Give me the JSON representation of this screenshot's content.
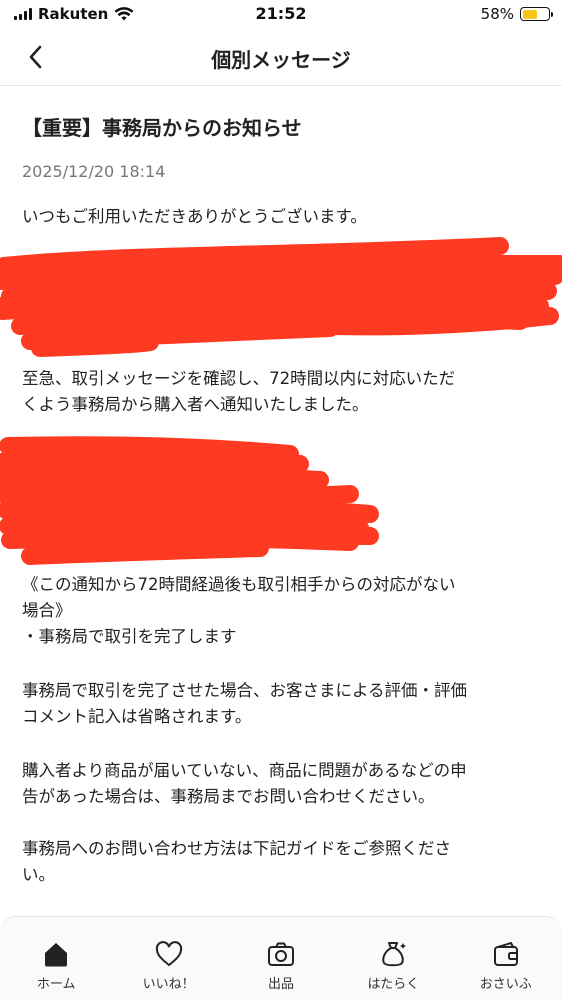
{
  "status_bar": {
    "carrier": "Rakuten",
    "time": "21:52",
    "battery": "58%",
    "battery_level": 0.58,
    "battery_color": "#f5c518"
  },
  "nav": {
    "title": "個別メッセージ",
    "back_icon": "chevron-left-icon"
  },
  "message": {
    "title": "【重要】事務局からのお知らせ",
    "date": "2025/12/20 18:14",
    "p1": "いつもご利用いただきありがとうございます。",
    "p2_line1": "至急、取引メッセージを確認し、72時間以内に対応いただ",
    "p2_line2": "くよう事務局から購入者へ通知いたしました。",
    "p3_line1": "《この通知から72時間経過後も取引相手からの対応がない",
    "p3_line2": "場合》",
    "p3_line3": "・事務局で取引を完了します",
    "p4_line1": "事務局で取引を完了させた場合、お客さまによる評価・評価",
    "p4_line2": "コメント記入は省略されます。",
    "p5_line1": "購入者より商品が届いていない、商品に問題があるなどの申",
    "p5_line2": "告があった場合は、事務局までお問い合わせください。",
    "p6_line1": "事務局へのお問い合わせ方法は下記ガイドをご参照くださ",
    "p6_line2": "い。"
  },
  "redaction_color": "#ff2a10",
  "tabs": [
    {
      "label": "ホーム",
      "icon": "home-icon"
    },
    {
      "label": "いいね！",
      "icon": "heart-icon"
    },
    {
      "label": "出品",
      "icon": "camera-icon"
    },
    {
      "label": "はたらく",
      "icon": "money-bag-icon"
    },
    {
      "label": "おさいふ",
      "icon": "wallet-icon"
    }
  ]
}
